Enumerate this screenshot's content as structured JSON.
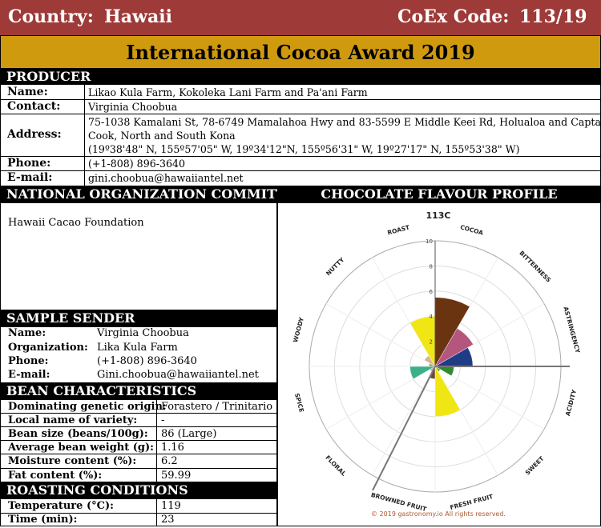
{
  "header": {
    "country_label": "Country:",
    "country": "Hawaii",
    "coex_label": "CoEx Code:",
    "coex_code": "113/19",
    "award_title": "International Cocoa Award 2019"
  },
  "producer": {
    "section_title": "PRODUCER",
    "name_label": "Name:",
    "name": "Likao Kula Farm, Kokoleka Lani Farm and Pa'ani Farm",
    "contact_label": "Contact:",
    "contact": "Virginia Choobua",
    "address_label": "Address:",
    "address_line1": "75-1038 Kamalani St, 78-6749 Mamalahoa Hwy and 83-5599 E Middle Keei Rd, Holualoa and Captain",
    "address_line2": "Cook, North and South Kona",
    "address_line3": "(19º38'48\" N, 155º57'05\" W, 19º34'12\"N, 155º56'31\" W, 19º27'17\" N, 155º53'38\" W)",
    "phone_label": "Phone:",
    "phone": "(+1-808) 896-3640",
    "email_label": "E-mail:",
    "email": "gini.choobua@hawaiiantel.net"
  },
  "noc": {
    "section_title": "NATIONAL ORGANIZATION COMMITTEE",
    "value": "Hawaii Cacao Foundation"
  },
  "sender": {
    "section_title": "SAMPLE SENDER",
    "name_label": "Name:",
    "name": "Virginia Choobua",
    "org_label": "Organization:",
    "org": "Lika Kula Farm",
    "phone_label": "Phone:",
    "phone": "(+1-808) 896-3640",
    "email_label": "E-mail:",
    "email": "Gini.choobua@hawaiiantel.net"
  },
  "bean": {
    "section_title": "BEAN CHARACTERISTICS",
    "rows": [
      {
        "label": "Dominating genetic origin:",
        "value": "Forastero / Trinitario"
      },
      {
        "label": "Local name of variety:",
        "value": "-"
      },
      {
        "label": "Bean size (beans/100g):",
        "value": "86 (Large)"
      },
      {
        "label": "Average bean weight (g):",
        "value": "1.16"
      },
      {
        "label": "Moisture content (%):",
        "value": "6.2"
      },
      {
        "label": "Fat content (%):",
        "value": "59.99"
      }
    ]
  },
  "roasting": {
    "section_title": "ROASTING CONDITIONS",
    "rows": [
      {
        "label": "Temperature (°C):",
        "value": "119"
      },
      {
        "label": "Time (min):",
        "value": "23"
      }
    ]
  },
  "profile": {
    "section_title": "CHOCOLATE FLAVOUR PROFILE",
    "credit": "© 2019 gastronomy.io All rights reserved."
  },
  "chart_data": {
    "type": "polar-area",
    "title": "113C",
    "categories": [
      "COCOA",
      "BITTERNESS",
      "ASTRINGENCY",
      "ACIDITY",
      "SWEET",
      "FRESH FRUIT",
      "BROWNED FRUIT",
      "FLORAL",
      "SPICE",
      "WOODY",
      "NUTTY",
      "ROAST"
    ],
    "values": [
      5.5,
      3.5,
      3,
      1.5,
      0.5,
      4,
      1,
      0.5,
      2,
      0.5,
      1,
      4
    ],
    "colors": [
      "#6b3410",
      "#b5567e",
      "#1f3d87",
      "#2e8b2e",
      "#9aab1c",
      "#f0e614",
      "#6b4a2a",
      "#d8b0a8",
      "#3cb08a",
      "#b8906a",
      "#d4b896",
      "#f0e614"
    ],
    "rlim": [
      0,
      10
    ],
    "r_ticks": [
      "2",
      "4",
      "6",
      "8",
      "10"
    ]
  }
}
